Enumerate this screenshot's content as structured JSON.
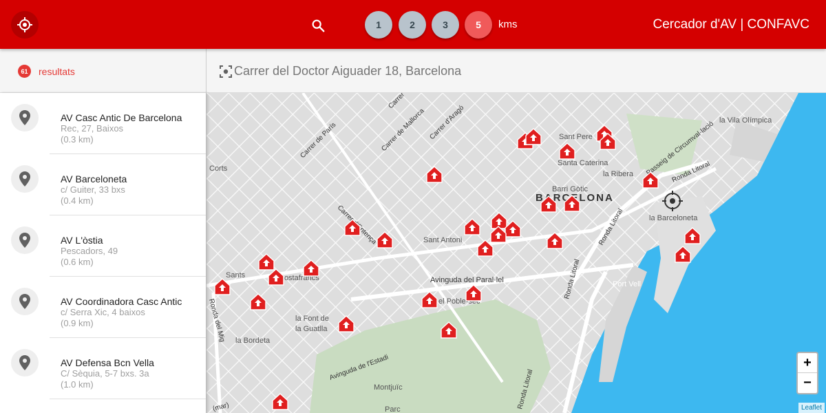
{
  "header": {
    "locate_icon": "crosshair-icon",
    "search_icon": "search-icon",
    "km_options": [
      "1",
      "2",
      "3",
      "5"
    ],
    "km_selected": "5",
    "km_unit": "kms",
    "title": "Cercador d'AV | CONFAVC",
    "colors": {
      "primary": "#d40000",
      "km_idle": "#b8c3cc",
      "km_active": "#f05a5a"
    }
  },
  "results": {
    "count": "61",
    "label": "resultats",
    "items": [
      {
        "name": "AV Casc Antic De Barcelona",
        "address": "Rec, 27, Baixos",
        "distance": "(0.3 km)"
      },
      {
        "name": "AV Barceloneta",
        "address": "c/ Guiter, 33 bxs",
        "distance": "(0.4 km)"
      },
      {
        "name": "AV L'òstia",
        "address": "Pescadors, 49",
        "distance": "(0.6 km)"
      },
      {
        "name": "AV Coordinadora Casc Antic",
        "address": "c/ Serra Xic, 4 baixos",
        "distance": "(0.9 km)"
      },
      {
        "name": "AV Defensa Bcn Vella",
        "address": "C/ Sèquia, 5-7 bxs. 3a",
        "distance": "(1.0 km)"
      }
    ]
  },
  "address": {
    "icon": "focus-frame-icon",
    "text": "Carrer del Doctor Aiguader 18, Barcelona"
  },
  "map": {
    "labels": {
      "barcelona": "BARCELONA",
      "sant_pere": "Sant Pere",
      "santa_caterina": "Santa Caterina",
      "la_ribera": "la Ribera",
      "barri_gotic": "Barri Gòtic",
      "la_barceloneta": "la Barceloneta",
      "port_vell": "Port Vell",
      "la_vila_olimpica": "la Vila Olímpica",
      "sant_antoni": "Sant Antoni",
      "el_poble_sec": "el Poble-sec",
      "la_font": "la Font de",
      "la_guatlla": "la Guatlla",
      "la_bordeta": "la Bordeta",
      "hostafrancs": "Hostafrancs",
      "sants": "Sants",
      "corts": "Corts",
      "montjuic": "Montjuïc",
      "parc": "Parc",
      "c_paris": "Carrer de París",
      "c_mallorca": "Carrer de Mallorca",
      "c_arago": "Carrer d'Aragó",
      "c_corsega": "Carrer",
      "c_entenca": "Carrer d'Entença",
      "av_parallel": "Avinguda del Paral·lel",
      "av_estadi": "Avinguda de l'Estadi",
      "ronda_litoral": "Ronda Litoral",
      "ronda_mig": "Ronda del Mig",
      "passeig_circ": "Passeig de Circumval·lació",
      "mar": "(mar)"
    },
    "marker_icon": "house-marker-icon",
    "center_icon": "target-icon",
    "zoom_in": "+",
    "zoom_out": "−",
    "attribution": "Leaflet"
  }
}
